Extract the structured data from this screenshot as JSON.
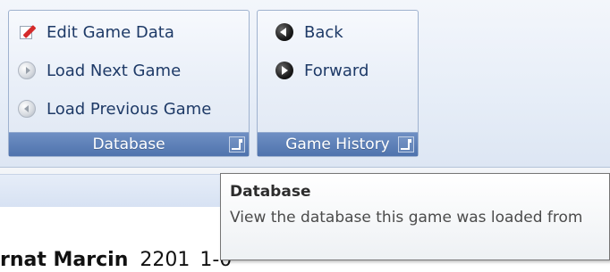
{
  "ribbon": {
    "database_group": {
      "label": "Database",
      "commands": [
        {
          "label": "Edit Game Data",
          "icon": "edit-game-data-icon"
        },
        {
          "label": "Load Next Game",
          "icon": "load-next-game-icon"
        },
        {
          "label": "Load Previous Game",
          "icon": "load-previous-game-icon"
        }
      ]
    },
    "history_group": {
      "label": "Game History",
      "commands": [
        {
          "label": "Back",
          "icon": "back-icon"
        },
        {
          "label": "Forward",
          "icon": "forward-icon"
        }
      ]
    }
  },
  "tooltip": {
    "title": "Database",
    "body": "View the database this game was loaded from"
  },
  "game": {
    "player_partial": "rnat Marcin",
    "rating": "2201",
    "result_partial": "1-0"
  },
  "colors": {
    "ribbon_blue": "#4f73ad",
    "text_blue": "#1e3a67",
    "tooltip_border": "#767676"
  }
}
